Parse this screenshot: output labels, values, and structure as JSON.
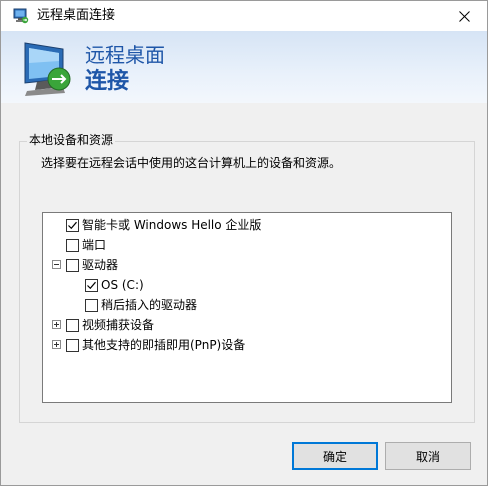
{
  "window": {
    "title": "远程桌面连接"
  },
  "banner": {
    "line1": "远程桌面",
    "line2": "连接"
  },
  "group": {
    "legend": "本地设备和资源",
    "description": "选择要在远程会话中使用的这台计算机上的设备和资源。"
  },
  "tree": [
    {
      "label": "智能卡或 Windows Hello 企业版",
      "checked": true,
      "expander": "none"
    },
    {
      "label": "端口",
      "checked": false,
      "expander": "none"
    },
    {
      "label": "驱动器",
      "checked": false,
      "expander": "expanded"
    },
    {
      "label": "OS (C:)",
      "checked": true,
      "expander": "none"
    },
    {
      "label": "稍后插入的驱动器",
      "checked": false,
      "expander": "none"
    },
    {
      "label": "视频捕获设备",
      "checked": false,
      "expander": "collapsed"
    },
    {
      "label": "其他支持的即插即用(PnP)设备",
      "checked": false,
      "expander": "collapsed"
    }
  ],
  "buttons": {
    "ok": "确定",
    "cancel": "取消"
  },
  "colors": {
    "accent": "#0078d7",
    "banner_text": "#1e56a8"
  },
  "icons": {
    "app": "remote-desktop-icon",
    "close": "close-icon",
    "check": "checkmark-icon"
  }
}
